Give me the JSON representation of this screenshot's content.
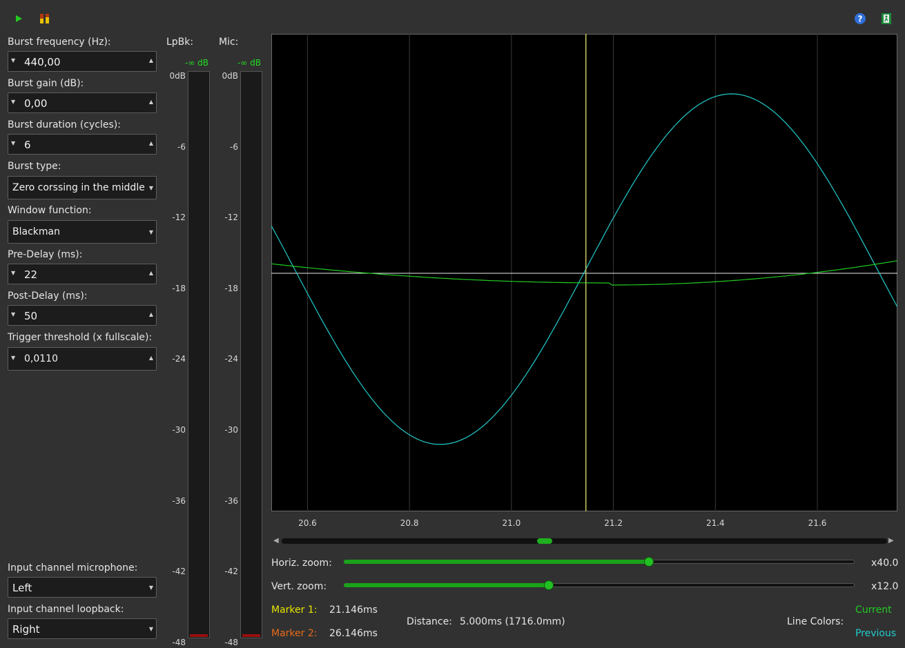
{
  "toolbar": {
    "play_icon": "play-icon",
    "meter_icon": "level-meter-icon",
    "help_icon": "help-icon",
    "exit_icon": "exit-icon"
  },
  "fields": {
    "burst_frequency": {
      "label": "Burst frequency (Hz):",
      "value": "440,00"
    },
    "burst_gain": {
      "label": "Burst gain (dB):",
      "value": "0,00"
    },
    "burst_duration": {
      "label": "Burst duration (cycles):",
      "value": "6"
    },
    "burst_type": {
      "label": "Burst type:",
      "value": "Zero corssing in the middle"
    },
    "window_function": {
      "label": "Window function:",
      "value": "Blackman"
    },
    "pre_delay": {
      "label": "Pre-Delay (ms):",
      "value": "22"
    },
    "post_delay": {
      "label": "Post-Delay (ms):",
      "value": "50"
    },
    "trigger_threshold": {
      "label": "Trigger threshold (x fullscale):",
      "value": "0,0110"
    },
    "input_mic": {
      "label": "Input channel microphone:",
      "value": "Left"
    },
    "input_loopback": {
      "label": "Input channel loopback:",
      "value": "Right"
    }
  },
  "meters": {
    "loopback": {
      "label": "LpBk:",
      "level": "-∞ dB"
    },
    "mic": {
      "label": "Mic:",
      "level": "-∞ dB"
    },
    "scale": [
      "0dB",
      "-6",
      "-12",
      "-18",
      "-24",
      "-30",
      "-36",
      "-42",
      "-48"
    ]
  },
  "plot": {
    "x_ticks": [
      "20.6",
      "20.8",
      "21.0",
      "21.2",
      "21.4",
      "21.6"
    ],
    "x_range": [
      20.529,
      21.757
    ],
    "marker_x": 21.146,
    "colors": {
      "current": "#22cc22",
      "previous": "#22cccc",
      "marker": "#c8c860",
      "zero_line": "#f0f0f0",
      "grid": "#3a3a3a"
    }
  },
  "zoom": {
    "horiz": {
      "label": "Horiz. zoom:",
      "value": "x40.0",
      "fraction": 0.597
    },
    "vert": {
      "label": "Vert. zoom:",
      "value": "x12.0",
      "fraction": 0.401
    },
    "scroll_fraction": 0.435
  },
  "markers": {
    "m1_label": "Marker 1:",
    "m1_value": "21.146ms",
    "m2_label": "Marker 2:",
    "m2_value": "26.146ms",
    "distance_label": "Distance:",
    "distance_value": "5.000ms (1716.0mm)",
    "line_colors_label": "Line Colors:",
    "current_label": "Current",
    "previous_label": "Previous"
  }
}
